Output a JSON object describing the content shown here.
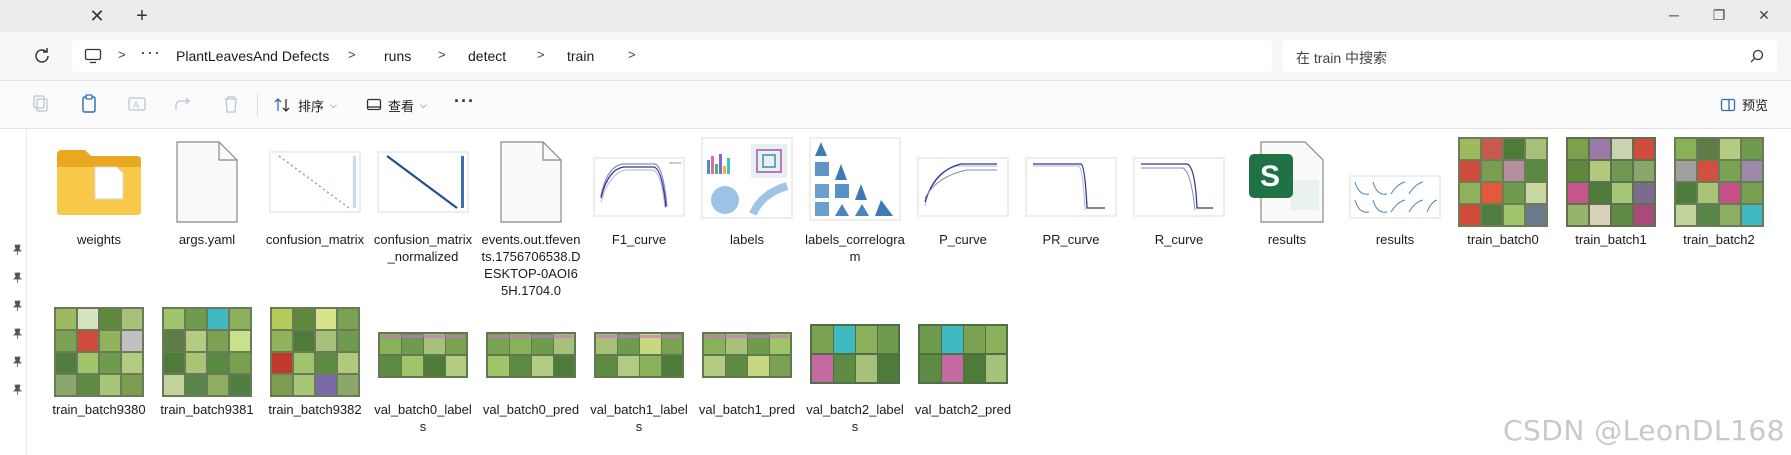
{
  "window": {
    "tab_close_glyph": "✕",
    "new_tab_glyph": "+",
    "minimize_glyph": "─",
    "restore_glyph": "❐",
    "close_glyph": "✕"
  },
  "address": {
    "more_glyph": "···",
    "breadcrumbs": [
      "PlantLeavesAnd Defects",
      "runs",
      "detect",
      "train"
    ],
    "search_placeholder": "在 train 中搜索"
  },
  "toolbar": {
    "sort_label": "排序",
    "view_label": "查看",
    "more_glyph": "···",
    "preview_label": "预览"
  },
  "files": [
    {
      "name": "weights",
      "icon": "folder-icon"
    },
    {
      "name": "args.yaml",
      "icon": "blank-file-icon"
    },
    {
      "name": "confusion_matrix",
      "icon": "confusion-matrix-thumbnail"
    },
    {
      "name": "confusion_matrix_normalized",
      "icon": "confusion-matrix-normalized-thumbnail"
    },
    {
      "name": "events.out.tfevents.1756706538.DESKTOP-0AOI65H.1704.0",
      "icon": "blank-file-icon"
    },
    {
      "name": "F1_curve",
      "icon": "curve-plot-thumbnail"
    },
    {
      "name": "labels",
      "icon": "labels-plot-thumbnail"
    },
    {
      "name": "labels_correlogram",
      "icon": "correlogram-thumbnail"
    },
    {
      "name": "P_curve",
      "icon": "curve-plot-thumbnail"
    },
    {
      "name": "PR_curve",
      "icon": "curve-plot-thumbnail"
    },
    {
      "name": "R_curve",
      "icon": "curve-plot-thumbnail"
    },
    {
      "name": "results",
      "icon": "spreadsheet-icon"
    },
    {
      "name": "results",
      "icon": "results-plot-thumbnail"
    },
    {
      "name": "train_batch0",
      "icon": "image-grid-thumbnail"
    },
    {
      "name": "train_batch1",
      "icon": "image-grid-thumbnail"
    },
    {
      "name": "train_batch2",
      "icon": "image-grid-thumbnail"
    },
    {
      "name": "train_batch9380",
      "icon": "image-grid-thumbnail"
    },
    {
      "name": "train_batch9381",
      "icon": "image-grid-thumbnail"
    },
    {
      "name": "train_batch9382",
      "icon": "image-grid-thumbnail"
    },
    {
      "name": "val_batch0_labels",
      "icon": "val-batch-thumbnail"
    },
    {
      "name": "val_batch0_pred",
      "icon": "val-batch-thumbnail"
    },
    {
      "name": "val_batch1_labels",
      "icon": "val-batch-thumbnail"
    },
    {
      "name": "val_batch1_pred",
      "icon": "val-batch-thumbnail"
    },
    {
      "name": "val_batch2_labels",
      "icon": "val-batch-thumbnail"
    },
    {
      "name": "val_batch2_pred",
      "icon": "val-batch-thumbnail"
    }
  ],
  "watermark": "CSDN @LeonDL168",
  "colors": {
    "folder": "#f5c242",
    "excel": "#1f7244",
    "accent": "#005fb8"
  }
}
